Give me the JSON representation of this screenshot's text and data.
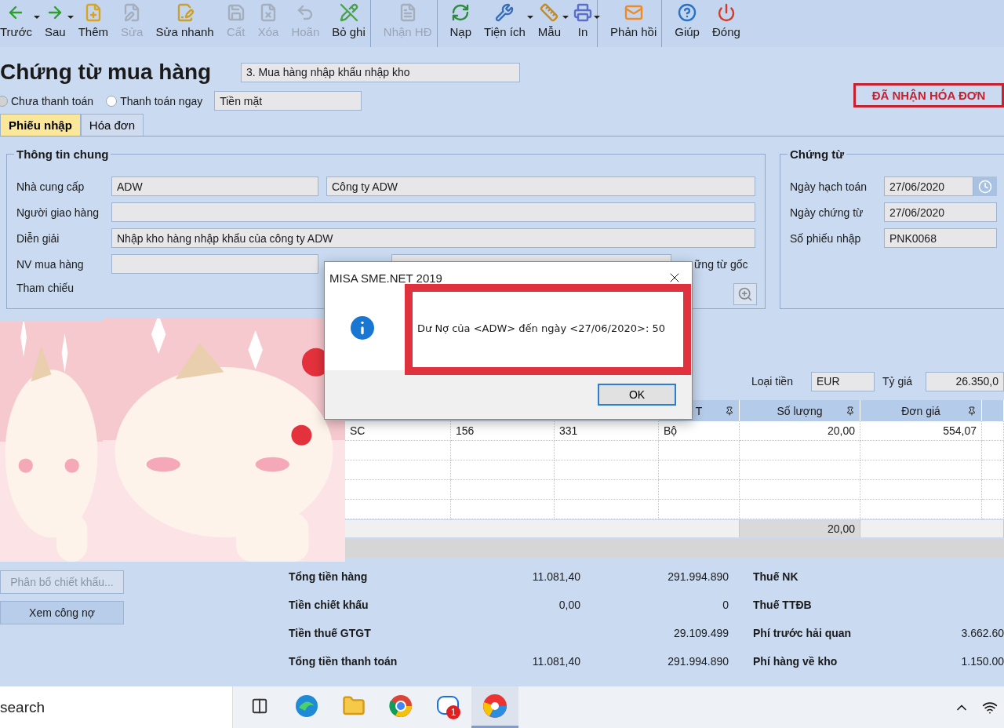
{
  "toolbar": [
    {
      "label": "Trước",
      "disabled": false,
      "dropdown": true,
      "separator_after": false
    },
    {
      "label": "Sau",
      "disabled": false,
      "dropdown": true,
      "separator_after": false
    },
    {
      "label": "Thêm",
      "disabled": false,
      "dropdown": false,
      "separator_after": false
    },
    {
      "label": "Sửa",
      "disabled": true,
      "dropdown": false,
      "separator_after": false
    },
    {
      "label": "Sửa nhanh",
      "disabled": false,
      "dropdown": false,
      "separator_after": false
    },
    {
      "label": "Cất",
      "disabled": true,
      "dropdown": false,
      "separator_after": false
    },
    {
      "label": "Xóa",
      "disabled": true,
      "dropdown": false,
      "separator_after": false
    },
    {
      "label": "Hoãn",
      "disabled": true,
      "dropdown": false,
      "separator_after": false
    },
    {
      "label": "Bỏ ghi",
      "disabled": false,
      "dropdown": false,
      "separator_after": true
    },
    {
      "label": "Nhận HĐ",
      "disabled": true,
      "dropdown": false,
      "separator_after": true
    },
    {
      "label": "Nạp",
      "disabled": false,
      "dropdown": false,
      "separator_after": false
    },
    {
      "label": "Tiện ích",
      "disabled": false,
      "dropdown": true,
      "separator_after": false
    },
    {
      "label": "Mẫu",
      "disabled": false,
      "dropdown": true,
      "separator_after": false
    },
    {
      "label": "In",
      "disabled": false,
      "dropdown": true,
      "separator_after": true
    },
    {
      "label": "Phản hồi",
      "disabled": false,
      "dropdown": false,
      "separator_after": true
    },
    {
      "label": "Giúp",
      "disabled": false,
      "dropdown": false,
      "separator_after": false
    },
    {
      "label": "Đóng",
      "disabled": false,
      "dropdown": false,
      "separator_after": false
    }
  ],
  "document": {
    "title": "Chứng từ mua hàng",
    "type": "3. Mua hàng nhập khẩu nhập kho",
    "payment_options": [
      {
        "label": "Chưa thanh toán",
        "selected": true
      },
      {
        "label": "Thanh toán ngay",
        "selected": false
      }
    ],
    "payment_method": "Tiền mặt",
    "status_badge": "ĐÃ NHẬN HÓA ĐƠN"
  },
  "tabs": [
    {
      "label": "Phiếu nhập",
      "selected": true
    },
    {
      "label": "Hóa đơn",
      "selected": false
    }
  ],
  "general": {
    "title": "Thông tin chung",
    "rows": [
      {
        "kind": "pair",
        "label": "Nhà cung cấp",
        "code": "ADW",
        "name": "Công ty ADW"
      },
      {
        "kind": "text",
        "label": "Người giao hàng"
      },
      {
        "kind": "text",
        "label": "Diễn giải",
        "value": "Nhập kho hàng nhập khẩu của công ty ADW"
      },
      {
        "kind": "staff",
        "label": "NV mua hàng",
        "extra_label": "ững từ gốc"
      },
      {
        "kind": "reference",
        "label": "Tham chiếu"
      }
    ]
  },
  "voucher": {
    "title": "Chứng từ",
    "rows": [
      {
        "label": "Ngày hạch toán",
        "value": "27/06/2020",
        "picker": true
      },
      {
        "label": "Ngày chứng từ",
        "value": "27/06/2020",
        "picker": false
      },
      {
        "label": "Số phiếu nhập",
        "value": "PNK0068",
        "picker": false
      }
    ]
  },
  "currency": {
    "currency_label": "Loại tiền",
    "currency": "EUR",
    "rate_label": "Tỷ giá",
    "rate": "26.350,0"
  },
  "table": {
    "columns": [
      {
        "label": "T"
      },
      {
        "label": "Số lượng"
      },
      {
        "label": "Đơn giá"
      }
    ],
    "rows": [
      [
        "SC",
        "156",
        "331",
        "Bộ",
        "20,00",
        "554,07"
      ]
    ],
    "total_quantity": "20,00"
  },
  "footer": {
    "buttons": [
      {
        "label": "Phân bổ chiết khấu...",
        "disabled": true
      },
      {
        "label": "Xem công nợ",
        "disabled": false
      }
    ],
    "totals": [
      {
        "label": "Tổng tiền hàng",
        "original": "11.081,40",
        "converted": "291.994.890"
      },
      {
        "label": "Tiền chiết khấu",
        "original": "0,00",
        "converted": "0"
      },
      {
        "label": "Tiền thuế GTGT",
        "converted": "29.109.499"
      },
      {
        "label": "Tổng tiền thanh toán",
        "original": "11.081,40",
        "converted": "291.994.890"
      }
    ],
    "costs": [
      {
        "label": "Thuế NK"
      },
      {
        "label": "Thuế TTĐB"
      },
      {
        "label": "Phí trước hải quan",
        "value": "3.662.60"
      },
      {
        "label": "Phí hàng về kho",
        "value": "1.150.00"
      }
    ]
  },
  "dialog": {
    "title": "MISA SME.NET 2019",
    "message": "Dư Nợ của <ADW> đến ngày <27/06/2020>: 50",
    "button": "OK"
  },
  "taskbar": {
    "search_placeholder": "search",
    "apps": [
      {
        "kind": "task-view",
        "active": false
      },
      {
        "kind": "wave",
        "active": false
      },
      {
        "kind": "folder",
        "active": false
      },
      {
        "kind": "ball",
        "active": false
      },
      {
        "kind": "chat",
        "active": false,
        "badge": "1"
      },
      {
        "kind": "wheel",
        "active": true
      }
    ]
  }
}
